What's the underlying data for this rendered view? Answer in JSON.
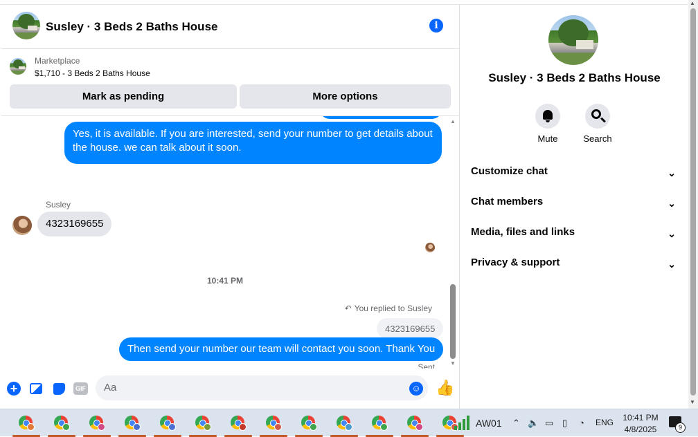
{
  "chat": {
    "title": "Susley · 3 Beds 2 Baths House",
    "marketplace": {
      "label": "Marketplace",
      "listing": "$1,710 - 3 Beds 2 Baths House",
      "mark_pending_label": "Mark as pending",
      "more_options_label": "More options"
    },
    "messages": {
      "outgoing_1": "Yes, it is available. If you are interested, send your number to get details about the house. we can talk about it soon.",
      "sender_name": "Susley",
      "incoming_1": "4323169655",
      "timestamp": "10:41 PM",
      "replied_note": "You replied to Susley",
      "quoted_text": "4323169655",
      "outgoing_2": "Then send your number our team will contact you soon. Thank You",
      "status": "Sent"
    },
    "composer": {
      "placeholder": "Aa",
      "gif_label": "GIF"
    },
    "accent_color": "#0084ff"
  },
  "panel": {
    "title": "Susley · 3 Beds 2 Baths House",
    "actions": {
      "mute_label": "Mute",
      "search_label": "Search"
    },
    "sections": {
      "customize": "Customize chat",
      "members": "Chat members",
      "media": "Media, files and links",
      "privacy": "Privacy & support"
    }
  },
  "taskbar": {
    "network_name": "AW01",
    "language": "ENG",
    "time": "10:41 PM",
    "date": "4/8/2025",
    "notification_count": "9",
    "profile_colors": [
      "#e07b39",
      "#3fa34d",
      "#d04a86",
      "#4a6fd0",
      "#4a6fd0",
      "#7a9a3a",
      "#c0392b",
      "#d05a4a",
      "#3fa34d",
      "#4a9ad0",
      "#3fa34d",
      "#d04a86",
      "#d05a4a"
    ]
  }
}
